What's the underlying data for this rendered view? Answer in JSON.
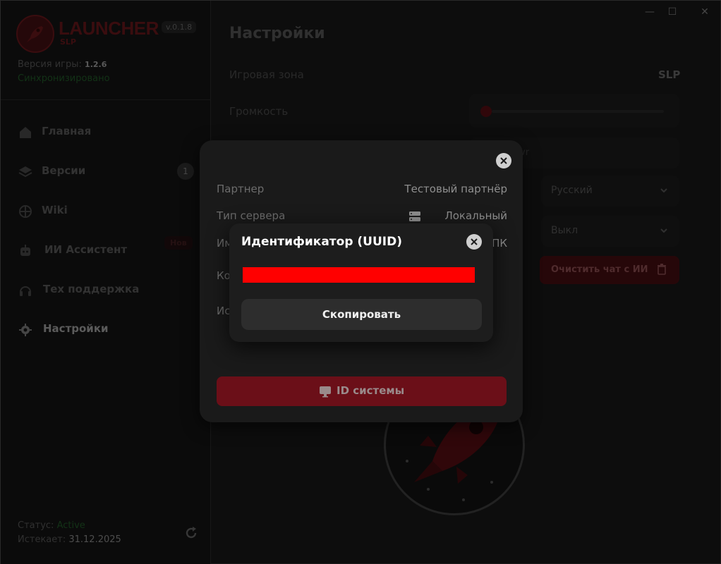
{
  "window": {
    "minimize": "—",
    "maximize": "☐",
    "close": "✕"
  },
  "sidebar": {
    "brand": "LAUNCHER",
    "brand_sub": "SLP",
    "version_badge": "v.0.1.8",
    "game_version_label": "Версия игры:",
    "game_version": "1.2.6",
    "sync_status": "Синхронизировано",
    "items": [
      {
        "label": "Главная",
        "icon": "home-icon"
      },
      {
        "label": "Версии",
        "icon": "layers-icon",
        "badge": "1"
      },
      {
        "label": "Wiki",
        "icon": "globe-icon"
      },
      {
        "label": "ИИ Ассистент",
        "icon": "robot-icon",
        "tag": "Нов"
      },
      {
        "label": "Тех поддержка",
        "icon": "headphones-icon"
      },
      {
        "label": "Настройки",
        "icon": "gear-icon",
        "active": true
      }
    ],
    "status_label": "Статус:",
    "status_value": "Active",
    "expires_label": "Истекает:",
    "expires_value": "31.12.2025"
  },
  "main": {
    "title": "Настройки",
    "game_zone_label": "Игровая зона",
    "game_zone_value": "SLP",
    "volume_label": "Громкость",
    "volume_level": 0.0,
    "bg_field_text": "vr",
    "language_value": "Русский",
    "toggle_value": "Выкл",
    "clear_chat_label": "Очистить чат с ИИ"
  },
  "modal_settings": {
    "partner_label": "Партнер",
    "partner_value": "Тестовый партнёр",
    "server_type_label": "Тип сервера",
    "server_type_value": "Локальный",
    "row3_label": "Им",
    "row3_value": "ПК",
    "row4_label": "Ко",
    "row5_label": "Ис",
    "system_id_button": "ID системы"
  },
  "modal_uuid": {
    "title": "Идентификатор (UUID)",
    "uuid_value": "████████████████████████████████████",
    "copy_button": "Скопировать"
  },
  "colors": {
    "accent": "#6b0f18",
    "redaction": "#ff0000",
    "green": "#1d4d23"
  }
}
